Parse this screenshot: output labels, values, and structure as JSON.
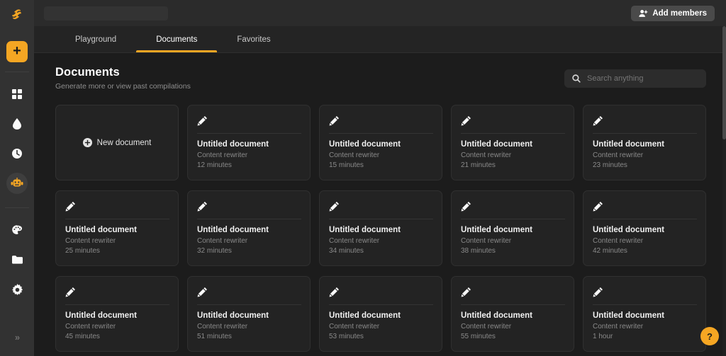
{
  "sidebar": {
    "logo": "swell-logo-icon",
    "add_button": {
      "icon": "plus-icon",
      "label": "+"
    },
    "items": [
      {
        "icon": "grid-dashboard-icon",
        "name": "dashboard",
        "active": false
      },
      {
        "icon": "droplet-icon",
        "name": "templates",
        "active": false
      },
      {
        "icon": "clock-history-icon",
        "name": "history",
        "active": false
      },
      {
        "icon": "robot-icon",
        "name": "ai-assistant",
        "active": true
      },
      {
        "icon": "palette-icon",
        "name": "brand",
        "active": false
      },
      {
        "icon": "folder-icon",
        "name": "files",
        "active": false
      },
      {
        "icon": "gear-icon",
        "name": "settings",
        "active": false
      }
    ],
    "collapse": {
      "icon": "double-chevron-right-icon",
      "label": "»"
    }
  },
  "topbar": {
    "add_members_label": "Add members",
    "add_members_icon": "user-plus-icon"
  },
  "tabs": [
    {
      "label": "Playground",
      "active": false
    },
    {
      "label": "Documents",
      "active": true
    },
    {
      "label": "Favorites",
      "active": false
    }
  ],
  "header": {
    "title": "Documents",
    "subtitle": "Generate more or view past compilations"
  },
  "search": {
    "placeholder": "Search anything",
    "value": "",
    "icon": "search-icon"
  },
  "new_document": {
    "label": "New document",
    "icon": "plus-circle-icon"
  },
  "documents": [
    {
      "title": "Untitled document",
      "type": "Content rewriter",
      "time": "12 minutes",
      "icon": "pencil-icon"
    },
    {
      "title": "Untitled document",
      "type": "Content rewriter",
      "time": "15 minutes",
      "icon": "pencil-icon"
    },
    {
      "title": "Untitled document",
      "type": "Content rewriter",
      "time": "21 minutes",
      "icon": "pencil-icon"
    },
    {
      "title": "Untitled document",
      "type": "Content rewriter",
      "time": "23 minutes",
      "icon": "pencil-icon"
    },
    {
      "title": "Untitled document",
      "type": "Content rewriter",
      "time": "25 minutes",
      "icon": "pencil-icon"
    },
    {
      "title": "Untitled document",
      "type": "Content rewriter",
      "time": "32 minutes",
      "icon": "pencil-icon"
    },
    {
      "title": "Untitled document",
      "type": "Content rewriter",
      "time": "34 minutes",
      "icon": "pencil-icon"
    },
    {
      "title": "Untitled document",
      "type": "Content rewriter",
      "time": "38 minutes",
      "icon": "pencil-icon"
    },
    {
      "title": "Untitled document",
      "type": "Content rewriter",
      "time": "42 minutes",
      "icon": "pencil-icon"
    },
    {
      "title": "Untitled document",
      "type": "Content rewriter",
      "time": "45 minutes",
      "icon": "pencil-icon"
    },
    {
      "title": "Untitled document",
      "type": "Content rewriter",
      "time": "51 minutes",
      "icon": "pencil-icon"
    },
    {
      "title": "Untitled document",
      "type": "Content rewriter",
      "time": "53 minutes",
      "icon": "pencil-icon"
    },
    {
      "title": "Untitled document",
      "type": "Content rewriter",
      "time": "55 minutes",
      "icon": "pencil-icon"
    },
    {
      "title": "Untitled document",
      "type": "Content rewriter",
      "time": "1 hour",
      "icon": "pencil-icon"
    }
  ],
  "help_button": {
    "label": "?",
    "icon": "question-mark-icon"
  },
  "colors": {
    "accent": "#f5a623",
    "sidebar_bg": "#323232",
    "page_bg": "#1c1c1c",
    "card_bg": "#232323",
    "topbar_bg": "#2b2b2b",
    "tabs_bg": "#242424"
  }
}
